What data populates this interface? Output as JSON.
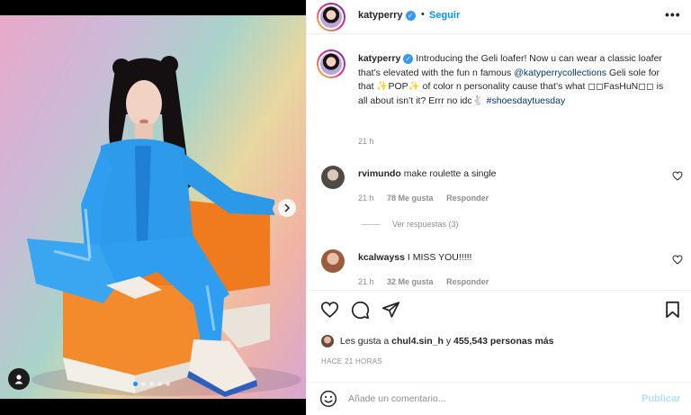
{
  "header": {
    "username": "katyperry",
    "verified_glyph": "✓",
    "separator": "•",
    "follow_label": "Seguir",
    "more_label": "•••"
  },
  "caption": {
    "username": "katyperry",
    "text_1": "Introducing the Geli loafer! Now u can wear a classic loafer that’s elevated with the fun n famous",
    "mention": "@katyperrycollections",
    "text_2": "Geli sole for that ✨POP✨ of color n personality cause that’s what ◻◻FasHuN◻◻ is all about isn’t it? Errr no idc🐇",
    "hashtag": "#shoesdaytuesday",
    "time": "21 h"
  },
  "comments": [
    {
      "username": "rvimundo",
      "text": "make roulette a single",
      "time": "21 h",
      "likes": "78 Me gusta",
      "reply_label": "Responder"
    },
    {
      "username": "kcalwayss",
      "text": "I MISS YOU!!!!!",
      "time": "21 h",
      "likes": "32 Me gusta",
      "reply_label": "Responder"
    }
  ],
  "view_replies": "Ver respuestas (3)",
  "likes": {
    "prefix": "Les gusta a",
    "user": "chul4.sin_h",
    "connector": "y",
    "count": "455,543 personas más"
  },
  "timestamp": "HACE 21 HORAS",
  "add_comment": {
    "placeholder": "Añade un comentario...",
    "publish_label": "Publicar"
  },
  "carousel": {
    "total": 5,
    "active_index": 0
  },
  "colors": {
    "accent": "#0095f6",
    "verified": "#3897f0",
    "publish_disabled": "#b2dffc",
    "muted": "#8e8e8e"
  },
  "icons": [
    "verified-icon",
    "more-icon",
    "heart-icon",
    "comment-icon",
    "share-icon",
    "bookmark-icon",
    "emoji-icon",
    "user-tag-icon",
    "chevron-right-icon"
  ]
}
